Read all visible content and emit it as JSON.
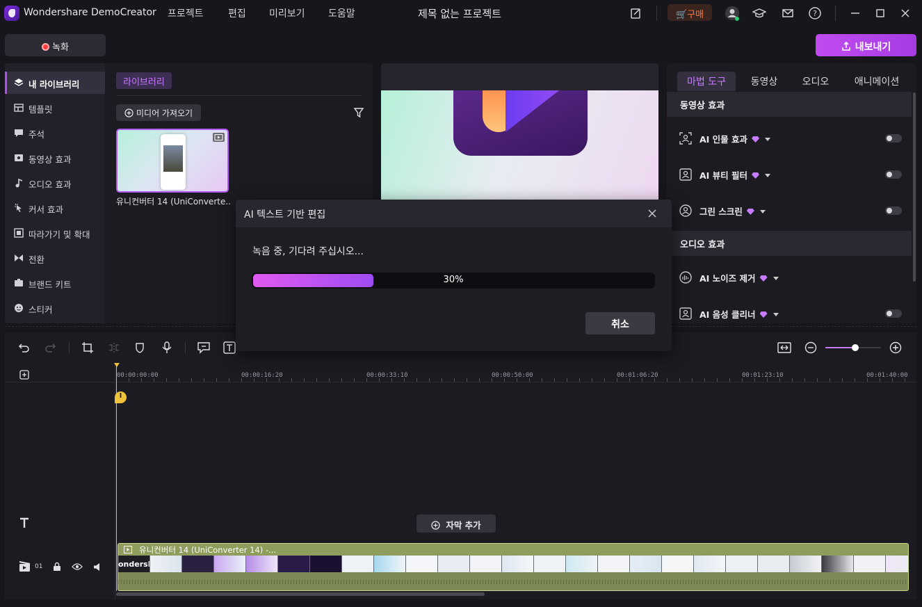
{
  "app": {
    "name": "Wondershare DemoCreator",
    "project_title": "제목 없는 프로젝트"
  },
  "menu": [
    "프로젝트",
    "편집",
    "미리보기",
    "도움말"
  ],
  "topbar": {
    "buy_label": "구매"
  },
  "buttons": {
    "record_label": "녹화",
    "export_label": "내보내기"
  },
  "sidebar": {
    "items": [
      {
        "label": "내 라이브러리",
        "icon": "layers-icon",
        "active": true
      },
      {
        "label": "템플릿",
        "icon": "template-icon"
      },
      {
        "label": "주석",
        "icon": "annotation-icon"
      },
      {
        "label": "동영상 효과",
        "icon": "video-effect-icon"
      },
      {
        "label": "오디오 효과",
        "icon": "music-note-icon"
      },
      {
        "label": "커서 효과",
        "icon": "cursor-icon"
      },
      {
        "label": "따라가기 및 확대",
        "icon": "zoom-icon"
      },
      {
        "label": "전환",
        "icon": "transition-icon"
      },
      {
        "label": "브랜드 키트",
        "icon": "brand-kit-icon"
      },
      {
        "label": "스티커",
        "icon": "sticker-icon"
      }
    ]
  },
  "library": {
    "tab_label": "라이브러리",
    "import_label": "미디어 가져오기",
    "media": [
      {
        "name": "유니컨버터 14 (UniConverte..."
      }
    ]
  },
  "right_panel": {
    "tabs": [
      "마법 도구",
      "동영상",
      "오디오",
      "애니메이션"
    ],
    "active_tab": 0,
    "sections": [
      {
        "title": "동영상 효과",
        "items": [
          {
            "label": "AI 인물 효과",
            "premium": true,
            "toggle": false
          },
          {
            "label": "AI 뷰티 필터",
            "premium": true,
            "toggle": false
          },
          {
            "label": "그린 스크린",
            "premium": true,
            "toggle": false
          }
        ]
      },
      {
        "title": "오디오 효과",
        "items": [
          {
            "label": "AI 노이즈 제거",
            "premium": true
          },
          {
            "label": "AI 음성 클리너",
            "premium": true,
            "toggle": false
          }
        ]
      }
    ]
  },
  "timeline": {
    "ruler": [
      "00:00:00:00",
      "00:00:16:20",
      "00:00:33:10",
      "00:00:50:00",
      "00:01:06:20",
      "00:01:23:10",
      "00:01:40:00"
    ],
    "playhead_label": "00:00:00:00",
    "add_subtitle_label": "자막 추가",
    "track_number": "01",
    "clip_title": "유니컨버터 14 (UniConverter 14) -...",
    "clip_frame_text": "ondersha"
  },
  "dialog": {
    "title": "AI 텍스트 기반 편집",
    "message": "녹음 중, 기다려 주십시오...",
    "progress": 30,
    "progress_label": "30%",
    "cancel_label": "취소"
  },
  "colors": {
    "accent": "#b04ef0",
    "playhead": "#f0c23b",
    "clip": "#7c8b52"
  }
}
